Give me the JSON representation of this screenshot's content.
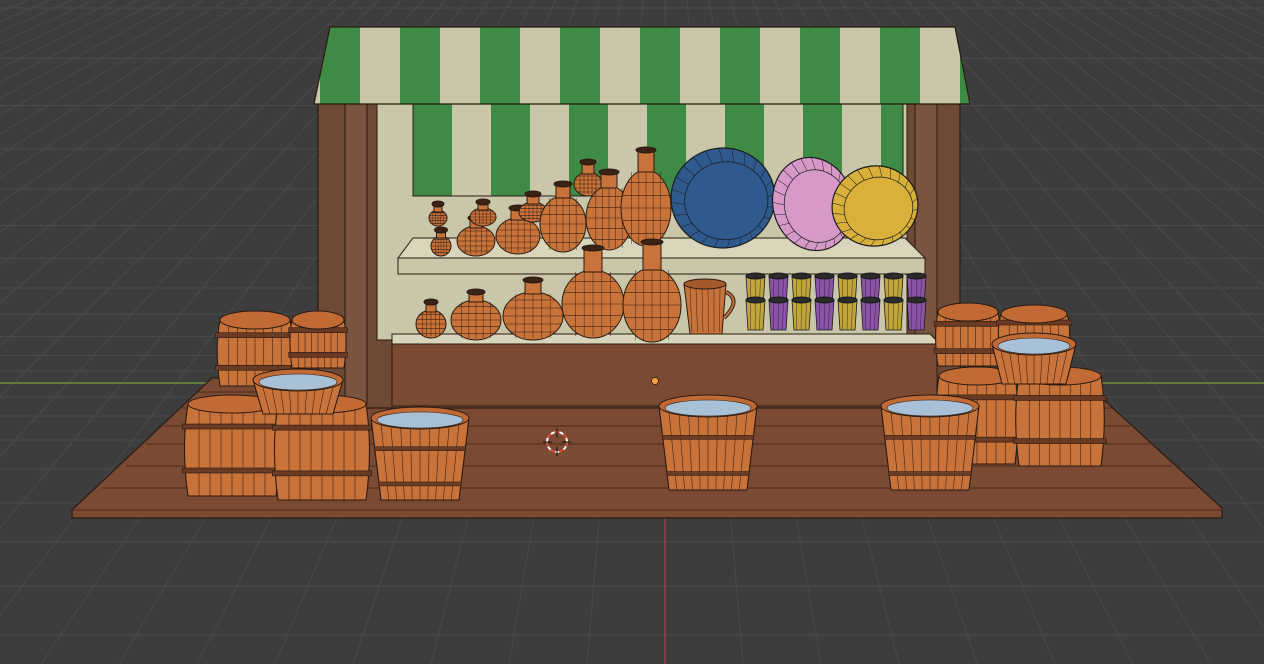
{
  "viewport": {
    "mode": "3d-viewport",
    "shading": "solid-wireframe",
    "colors": {
      "background": "#3d3d3d",
      "grid_line": "#4a4a4a",
      "x_axis": "#7a9a3a",
      "y_axis": "#a8434f",
      "wood_light": "#c8733a",
      "wood_dark": "#7a4a32",
      "awning_green": "#3f8a45",
      "awning_cream": "#c9c6a9",
      "water": "#a9c1d6",
      "origin": "#f7a03a"
    }
  },
  "scene": {
    "objects": [
      "market-stall",
      "awning",
      "shelves",
      "vases",
      "bowls",
      "cups",
      "barrels",
      "buckets",
      "wooden-platform"
    ],
    "bowls": [
      {
        "name": "blue-bowl",
        "color": "#2f5a8e"
      },
      {
        "name": "pink-bowl",
        "color": "#d79ac8"
      },
      {
        "name": "yellow-bowl",
        "color": "#d9b13a"
      }
    ],
    "cups": [
      {
        "color": "#c2a53a"
      },
      {
        "color": "#8c52a8"
      },
      {
        "color": "#c2a53a"
      },
      {
        "color": "#8c52a8"
      },
      {
        "color": "#c2a53a"
      },
      {
        "color": "#8c52a8"
      },
      {
        "color": "#c2a53a"
      },
      {
        "color": "#8c52a8"
      }
    ]
  },
  "cursor": {
    "icon": "3d-cursor-icon"
  },
  "origin": {
    "icon": "origin-dot-icon"
  }
}
